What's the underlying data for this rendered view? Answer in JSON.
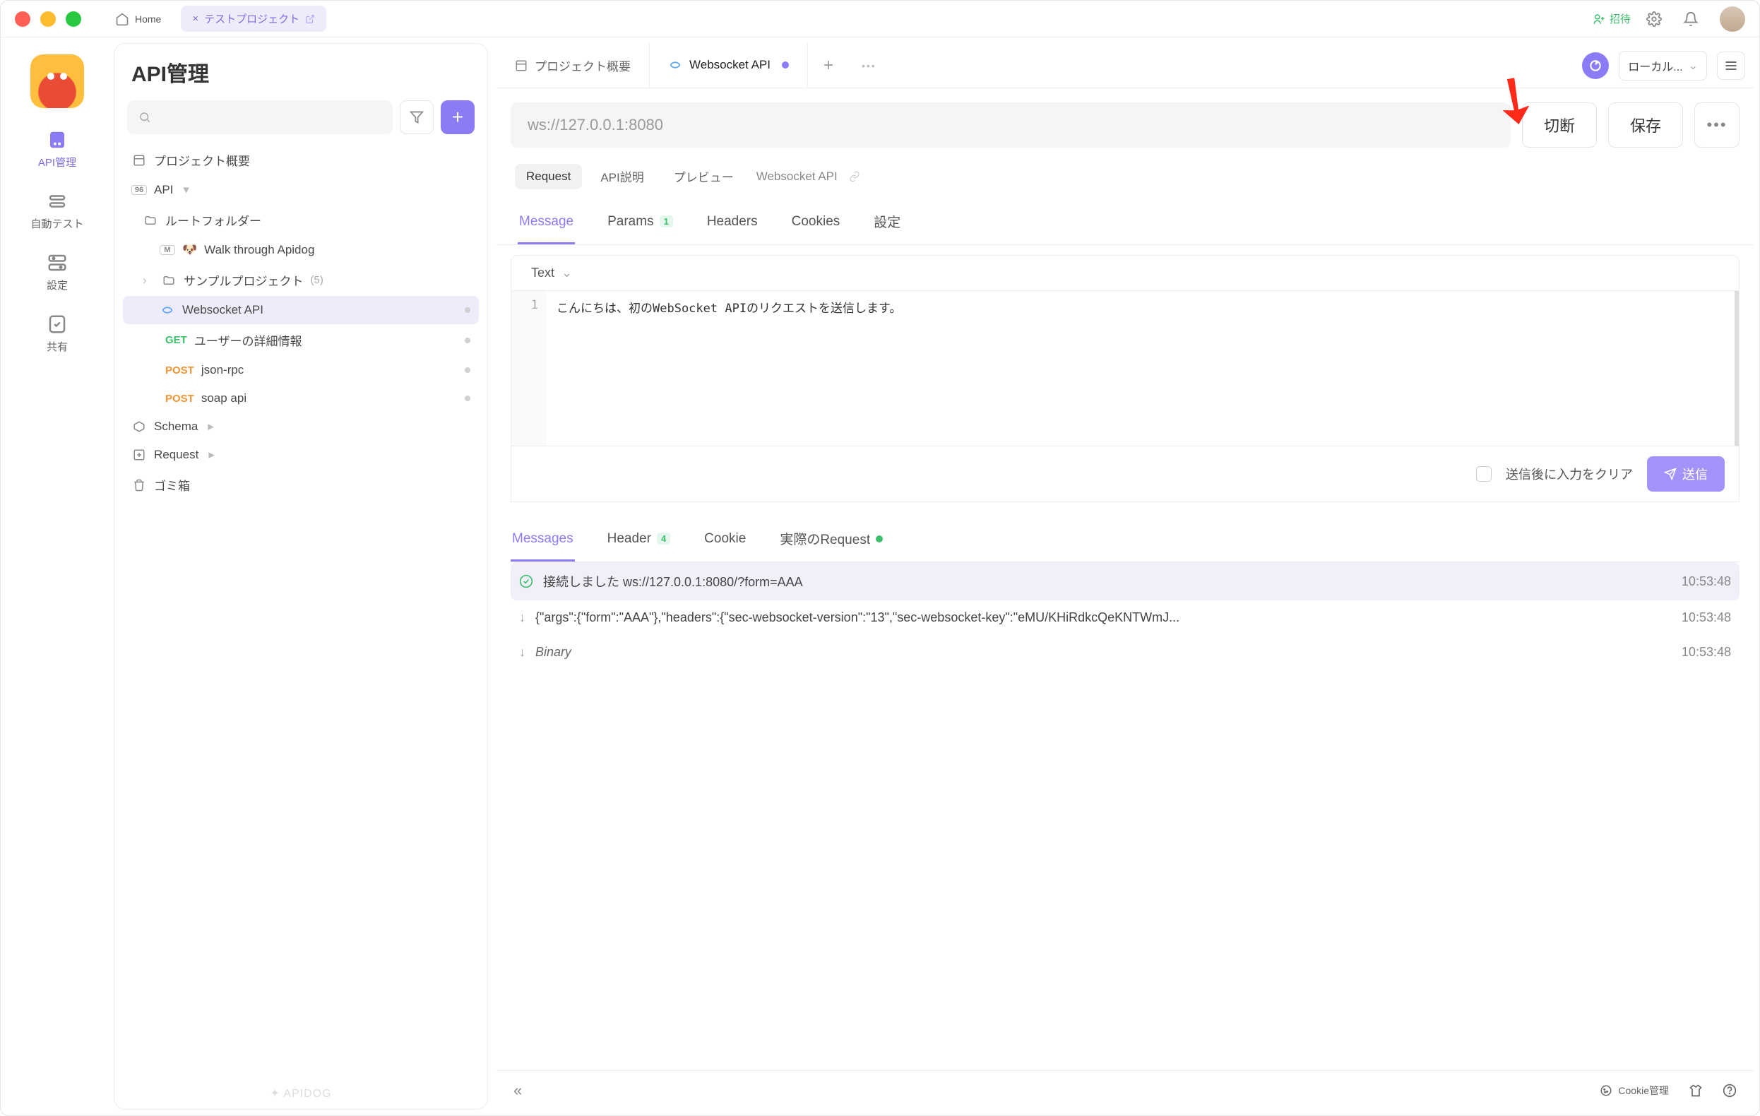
{
  "titlebar": {
    "home": "Home",
    "project_tab": "テストプロジェクト",
    "invite": "招待"
  },
  "leftrail": {
    "api": "API管理",
    "autotest": "自動テスト",
    "settings": "設定",
    "share": "共有"
  },
  "sidebar": {
    "title": "API管理",
    "overview": "プロジェクト概要",
    "api_label": "API",
    "root_folder": "ルートフォルダー",
    "walk": "Walk through Apidog",
    "sample_project": "サンプルプロジェクト",
    "sample_count": "(5)",
    "websocket": "Websocket API",
    "get_detail": "ユーザーの詳細情報",
    "get_label": "GET",
    "post_label": "POST",
    "jsonrpc": "json-rpc",
    "soap": "soap api",
    "schema": "Schema",
    "request": "Request",
    "trash": "ゴミ箱",
    "brand": "APIDOG"
  },
  "main": {
    "tabs": {
      "overview": "プロジェクト概要",
      "websocket": "Websocket API"
    },
    "env": "ローカル...",
    "url": "ws://127.0.0.1:8080",
    "disconnect": "切断",
    "save": "保存",
    "pill_request": "Request",
    "pill_api_desc": "API説明",
    "pill_preview": "プレビュー",
    "pill_name": "Websocket API",
    "inner_tabs": {
      "message": "Message",
      "params": "Params",
      "params_badge": "1",
      "headers": "Headers",
      "cookies": "Cookies",
      "settings": "設定"
    },
    "editor": {
      "type": "Text",
      "line1_no": "1",
      "line1": "こんにちは、初のWebSocket APIのリクエストを送信します。",
      "clear_after_send": "送信後に入力をクリア",
      "send": "送信"
    },
    "msg_tabs": {
      "messages": "Messages",
      "header": "Header",
      "header_badge": "4",
      "cookie": "Cookie",
      "actual": "実際のRequest"
    },
    "log": {
      "connected": "接続しました ws://127.0.0.1:8080/?form=AAA",
      "t1": "10:53:48",
      "json": "{\"args\":{\"form\":\"AAA\"},\"headers\":{\"sec-websocket-version\":\"13\",\"sec-websocket-key\":\"eMU/KHiRdkcQeKNTWmJ...",
      "t2": "10:53:48",
      "binary": "Binary",
      "t3": "10:53:48"
    },
    "bottom": {
      "cookie_mgmt": "Cookie管理"
    }
  }
}
